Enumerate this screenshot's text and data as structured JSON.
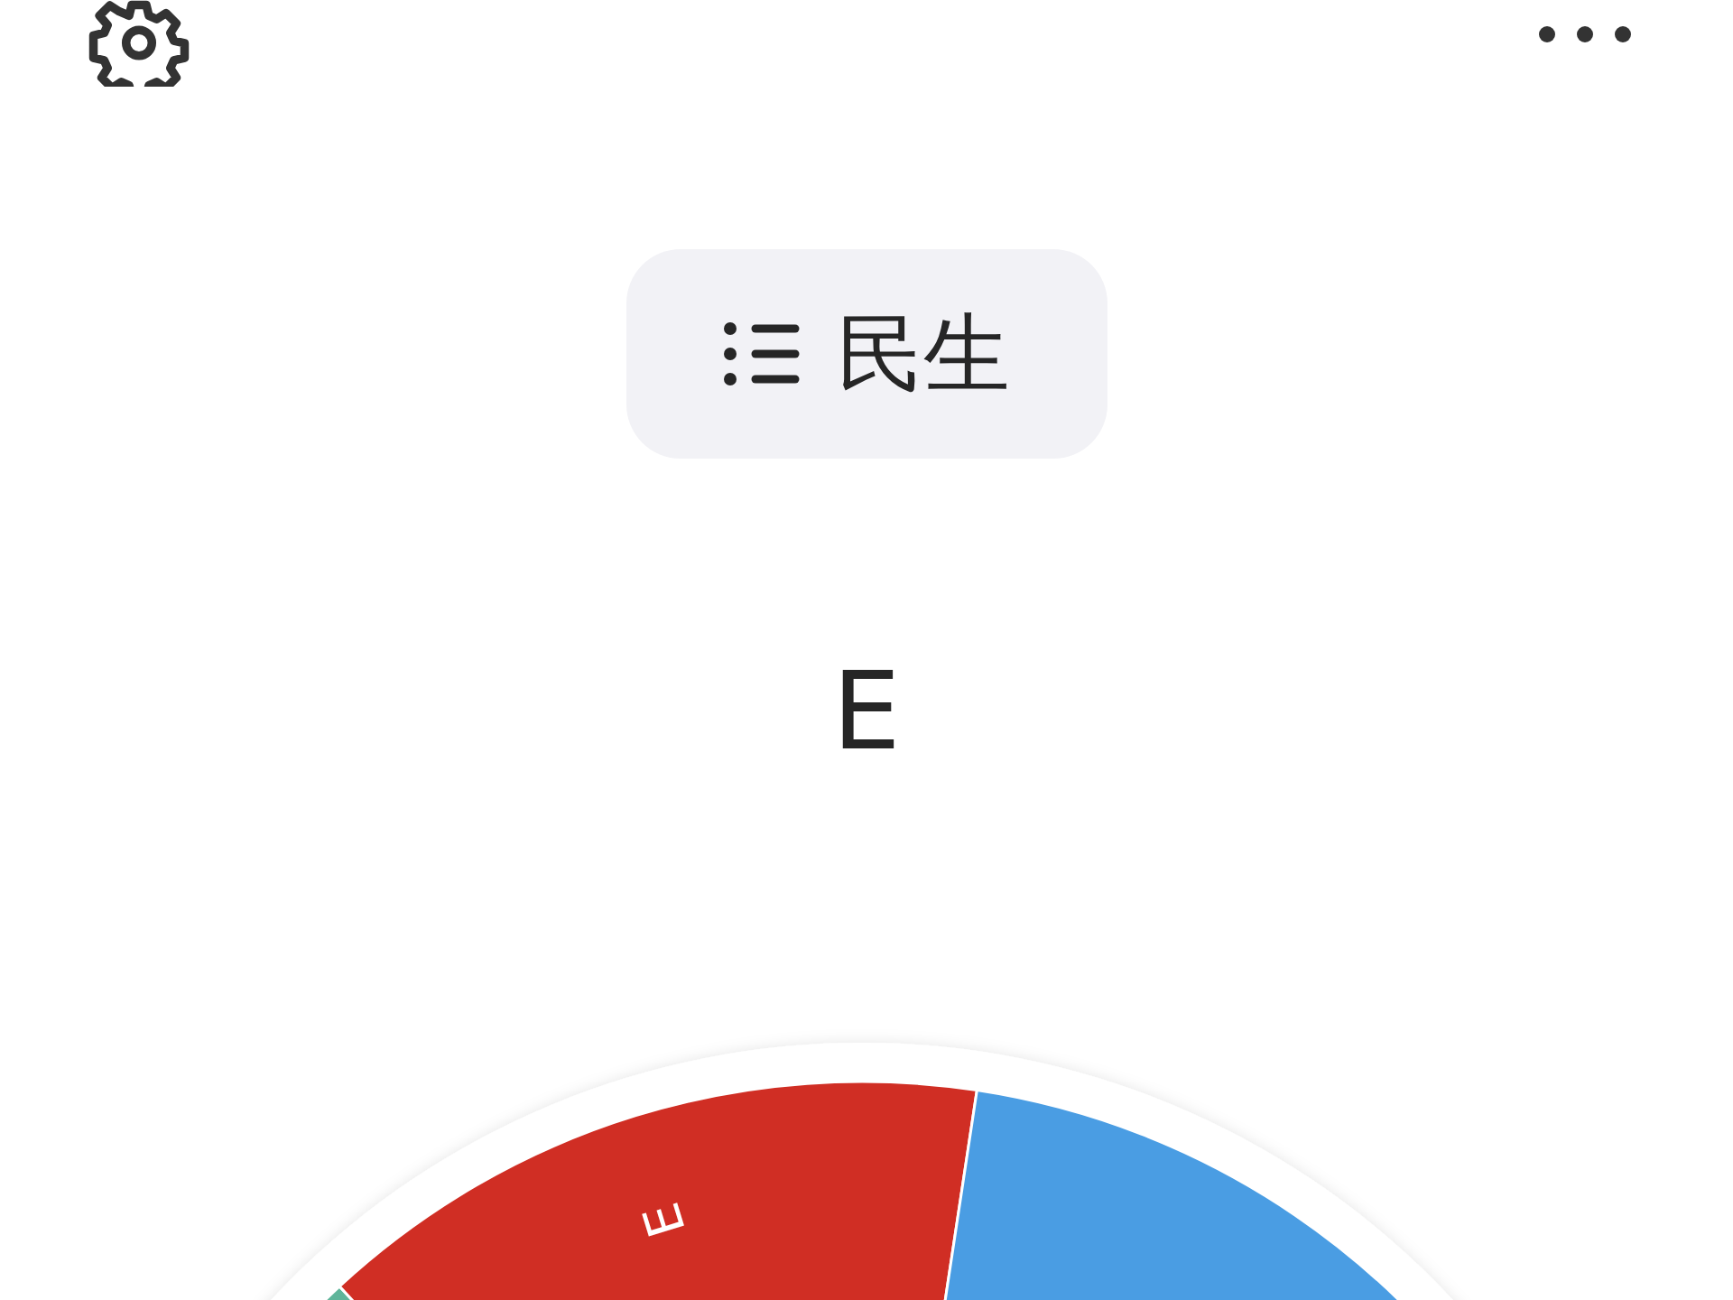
{
  "category_button": {
    "label": "民生"
  },
  "result": "E",
  "wheel": {
    "segments": [
      {
        "color": "#5fb59a"
      },
      {
        "color": "#d02e24",
        "label": "E"
      },
      {
        "color": "#4a9de3"
      }
    ]
  }
}
